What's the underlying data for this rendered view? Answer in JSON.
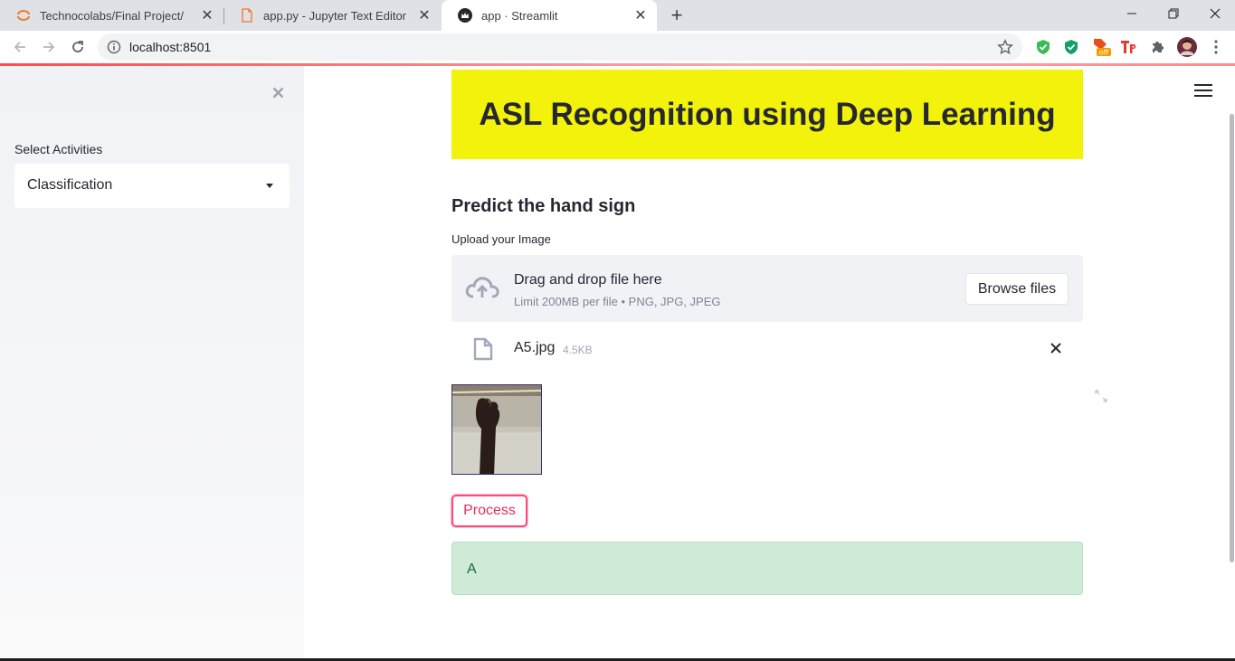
{
  "browser": {
    "tabs": [
      {
        "title": "Technocolabs/Final Project/",
        "favicon": "jupyter-ring-icon",
        "active": false
      },
      {
        "title": "app.py - Jupyter Text Editor",
        "favicon": "file-icon",
        "active": false
      },
      {
        "title": "app · Streamlit",
        "favicon": "streamlit-crown-icon",
        "active": true
      }
    ],
    "url": "localhost:8501",
    "extension_badge": "off",
    "colors": {
      "tabbar": "#dee1e6",
      "accent": "#ff4b4b"
    }
  },
  "sidebar": {
    "select_label": "Select Activities",
    "select_value": "Classification"
  },
  "main": {
    "title": "ASL Recognition using Deep Learning",
    "title_bg": "#f2f20a",
    "subheader": "Predict the hand sign",
    "uploader": {
      "label": "Upload your Image",
      "drop_text": "Drag and drop file here",
      "limit_text": "Limit 200MB per file • PNG, JPG, JPEG",
      "browse_label": "Browse files",
      "file_name": "A5.jpg",
      "file_size": "4.5KB"
    },
    "process_label": "Process",
    "result_text": "A",
    "result_color": "#cdebd7"
  }
}
